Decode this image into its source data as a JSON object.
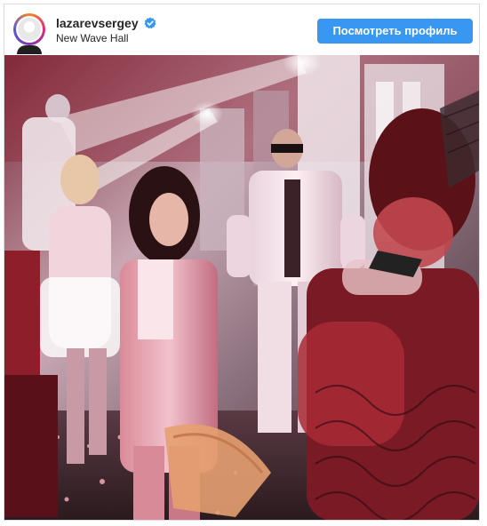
{
  "post": {
    "username": "lazarevsergey",
    "verified": true,
    "location": "New Wave Hall",
    "profile_button_label": "Посмотреть профиль",
    "avatar_icon": "avatar-icon",
    "verified_icon": "verified-badge-icon"
  },
  "colors": {
    "button_bg": "#3897f0",
    "button_text": "#ffffff",
    "verified_badge": "#3897f0",
    "border": "#dbdbdb",
    "text": "#262626"
  }
}
